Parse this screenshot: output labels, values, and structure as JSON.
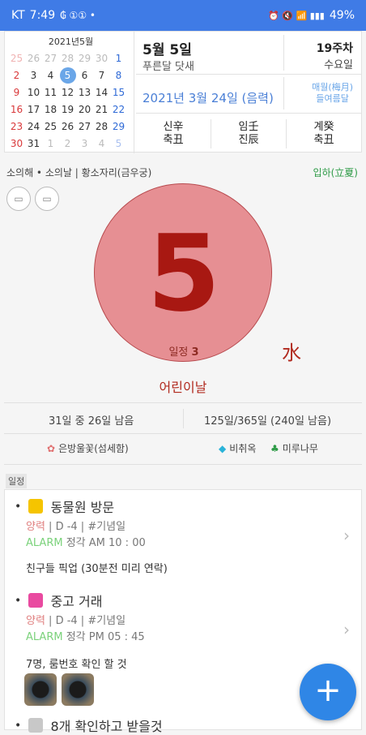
{
  "status_bar": {
    "carrier": "KT",
    "time": "7:49",
    "indicators": "₲ ①①  •",
    "right_icons": "⏰ 🔇 📶 ▮▮▮",
    "battery": "49%"
  },
  "mini_calendar": {
    "title": "2021년5월",
    "weeks": [
      [
        "25",
        "26",
        "27",
        "28",
        "29",
        "30",
        "1"
      ],
      [
        "2",
        "3",
        "4",
        "5",
        "6",
        "7",
        "8"
      ],
      [
        "9",
        "10",
        "11",
        "12",
        "13",
        "14",
        "15"
      ],
      [
        "16",
        "17",
        "18",
        "19",
        "20",
        "21",
        "22"
      ],
      [
        "23",
        "24",
        "25",
        "26",
        "27",
        "28",
        "29"
      ],
      [
        "30",
        "31",
        "1",
        "2",
        "3",
        "4",
        "5"
      ]
    ],
    "today": "5"
  },
  "header": {
    "date": "5월 5일",
    "lunar_name": "푸른달 닷새",
    "week": "19주차",
    "weekday": "수요일",
    "lunar_date": "2021년 3월 24일 (음력)",
    "lunar_extra_1": "매월(梅月)",
    "lunar_extra_2": "들여름달"
  },
  "ganji": [
    {
      "top": "신辛",
      "bottom": "축丑"
    },
    {
      "top": "임壬",
      "bottom": "진辰"
    },
    {
      "top": "계癸",
      "bottom": "축丑"
    }
  ],
  "zodiac_line": "소의해 • 소의날 | 황소자리(금우궁)",
  "solar_term": "입하(立夏)",
  "big_day": "5",
  "schedule_label": "일정",
  "schedule_count": "3",
  "element": "水",
  "holiday": "어린이날",
  "month_progress": "31일 중 26일 남음",
  "year_progress": "125일/365일 (240일 남음)",
  "flower": "은방울꽃(섬세함)",
  "gem": "비취옥",
  "tree": "미루나무",
  "section_tag": "일정",
  "events": [
    {
      "title": "동물원 방문",
      "color": "#f5c400",
      "meta_red": "양력",
      "meta_gray": " | D -4 | #기념일",
      "alarm": "ALARM",
      "alarm_time": " 정각  AM 10 : 00",
      "note": "친구들 픽업 (30분전 미리 연락)"
    },
    {
      "title": "중고 거래",
      "color": "#e94aa0",
      "meta_red": "양력",
      "meta_gray": " | D -4 | #기념일",
      "alarm": "ALARM",
      "alarm_time": " 정각  PM 05 : 45",
      "note": "7명, 룸번호 확인 할 것"
    },
    {
      "title": "8개 확인하고 받을것",
      "color": "#c8c8c8"
    }
  ],
  "fab_label": "+",
  "colors": {
    "accent": "#3f7be6",
    "today_circle": "#e68f93",
    "holiday": "#b12a1f"
  }
}
